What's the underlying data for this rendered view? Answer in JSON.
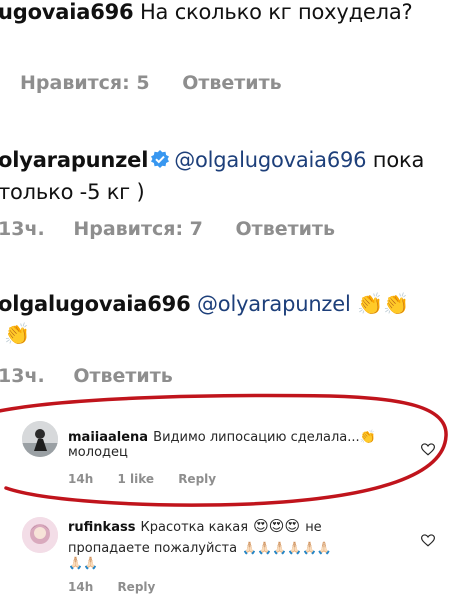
{
  "comment1": {
    "username_fragment": "ugovaia696",
    "text": "На сколько кг похудела?",
    "likes": "Нравится: 5",
    "reply": "Ответить"
  },
  "comment2": {
    "username_fragment": "olyarapunzel",
    "mention": "@olgalugovaia696",
    "text_line1_end": "пока",
    "text_line2": "только -5 кг )",
    "time": "13ч.",
    "likes": "Нравится: 7",
    "reply": "Ответить"
  },
  "comment3": {
    "username_fragment": "olgalugovaia696",
    "mention": "@olyarapunzel",
    "emoji_line1": "👏👏",
    "emoji_line2": "👏",
    "time": "13ч.",
    "reply": "Ответить"
  },
  "comment4": {
    "username": "maiiaalena",
    "text_line1": "Видимо липосацию сделала...👏",
    "text_line2": "молодец",
    "time": "14h",
    "likes": "1 like",
    "reply": "Reply"
  },
  "comment5": {
    "username": "rufinkass",
    "text_line1_prefix": "Красотка какая",
    "emoji_hearts": "😍😍😍",
    "text_line1_suffix": "не",
    "text_line2": "пропадаете пожалуйста",
    "emoji_pray_line2": "🙏🏻🙏🏻🙏🏻🙏🏻🙏🏻🙏🏻",
    "emoji_pray_line3": "🙏🏻🙏🏻",
    "time": "14h",
    "reply": "Reply"
  },
  "colors": {
    "mention": "#1d3f7a",
    "muted": "#8e8e8e",
    "highlight_stroke": "#c0141c",
    "verified": "#3897f0"
  }
}
